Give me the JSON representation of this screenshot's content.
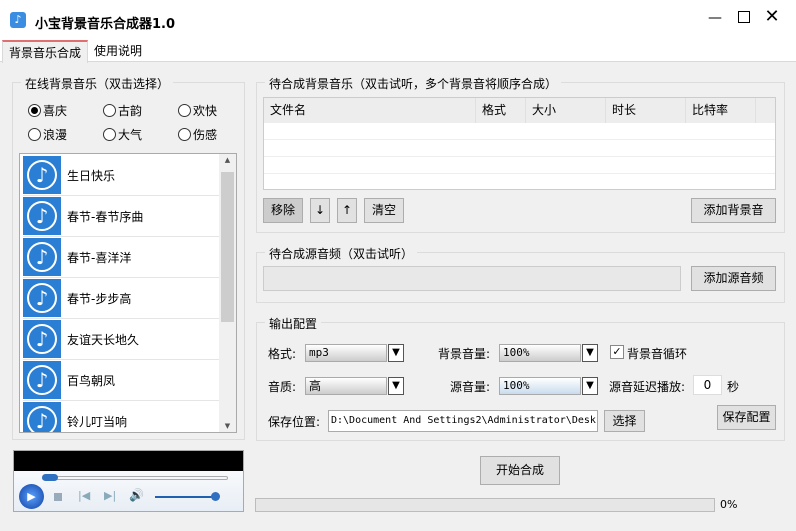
{
  "window": {
    "title": "小宝背景音乐合成器1.0"
  },
  "tabs": [
    "背景音乐合成",
    "使用说明"
  ],
  "online": {
    "title": "在线背景音乐（双击选择）",
    "categories": [
      "喜庆",
      "古韵",
      "欢快",
      "浪漫",
      "大气",
      "伤感"
    ],
    "selected": 0,
    "songs": [
      "生日快乐",
      "春节-春节序曲",
      "春节-喜洋洋",
      "春节-步步高",
      "友谊天长地久",
      "百鸟朝凤",
      "铃儿叮当响"
    ]
  },
  "bgmusic": {
    "title": "待合成背景音乐（双击试听，多个背景音将顺序合成）",
    "columns": [
      "文件名",
      "格式",
      "大小",
      "时长",
      "比特率"
    ],
    "remove": "移除",
    "down": "↓",
    "up": "↑",
    "clear": "清空",
    "add": "添加背景音"
  },
  "source": {
    "title": "待合成源音频（双击试听）",
    "add": "添加源音频"
  },
  "output": {
    "title": "输出配置",
    "format_label": "格式:",
    "format": "mp3",
    "bgvol_label": "背景音量:",
    "bgvol": "100%",
    "loop_label": "背景音循环",
    "loop": true,
    "quality_label": "音质:",
    "quality": "高",
    "srcvol_label": "源音量:",
    "srcvol": "100%",
    "delay_label": "源音延迟播放:",
    "delay": "0",
    "sec": "秒",
    "path_label": "保存位置:",
    "path": "D:\\Document And Settings2\\Administrator\\Desk",
    "choose": "选择",
    "save": "保存配置"
  },
  "start": "开始合成",
  "progress": {
    "value": 0,
    "text": "0%"
  }
}
